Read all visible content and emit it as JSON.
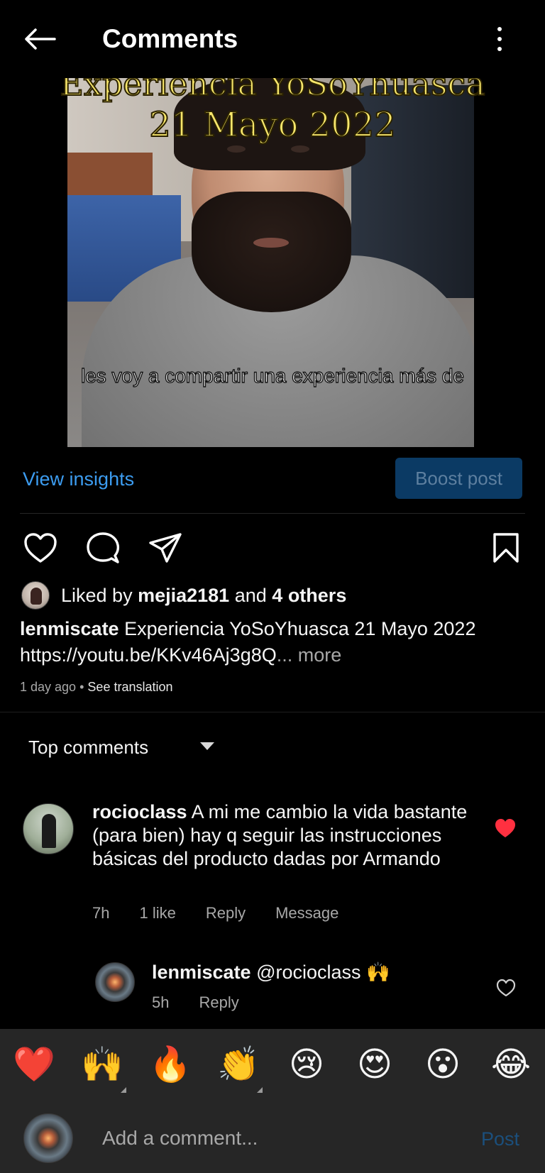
{
  "header": {
    "title": "Comments"
  },
  "video": {
    "overlay_title": "Experiencia YoSoYhuasca",
    "overlay_date": "21 Mayo 2022",
    "subtitle": "les voy a compartir una experiencia más de"
  },
  "insights": {
    "view_label": "View insights",
    "boost_label": "Boost post"
  },
  "likes": {
    "prefix": "Liked by",
    "user": "mejia2181",
    "and": "and",
    "others": "4 others"
  },
  "caption": {
    "username": "lenmiscate",
    "text": "Experiencia YoSoYhuasca 21 Mayo 2022",
    "link": "https://youtu.be/KKv46Aj3g8Q",
    "ellipsis": "...",
    "more": "more",
    "time": "1 day ago",
    "separator": "•",
    "see_translation": "See translation"
  },
  "sort": {
    "label": "Top comments"
  },
  "comments": [
    {
      "username": "rocioclass",
      "text": "A mi me cambio la vida bastante (para bien) hay q seguir las instrucciones básicas del producto dadas por Armando",
      "time": "7h",
      "likes": "1 like",
      "reply": "Reply",
      "message": "Message",
      "liked": true
    },
    {
      "username": "lenmiscate",
      "text": "@rocioclass 🙌",
      "time": "5h",
      "reply": "Reply",
      "liked": false
    }
  ],
  "reactions": [
    "❤️",
    "🙌",
    "🔥",
    "👏",
    "😢",
    "😍",
    "😮",
    "😂"
  ],
  "composer": {
    "placeholder": "Add a comment...",
    "post_label": "Post"
  },
  "colors": {
    "accent_blue": "#3c9cf0",
    "like_red": "#ff3040",
    "boost_bg": "#0b3a64"
  }
}
